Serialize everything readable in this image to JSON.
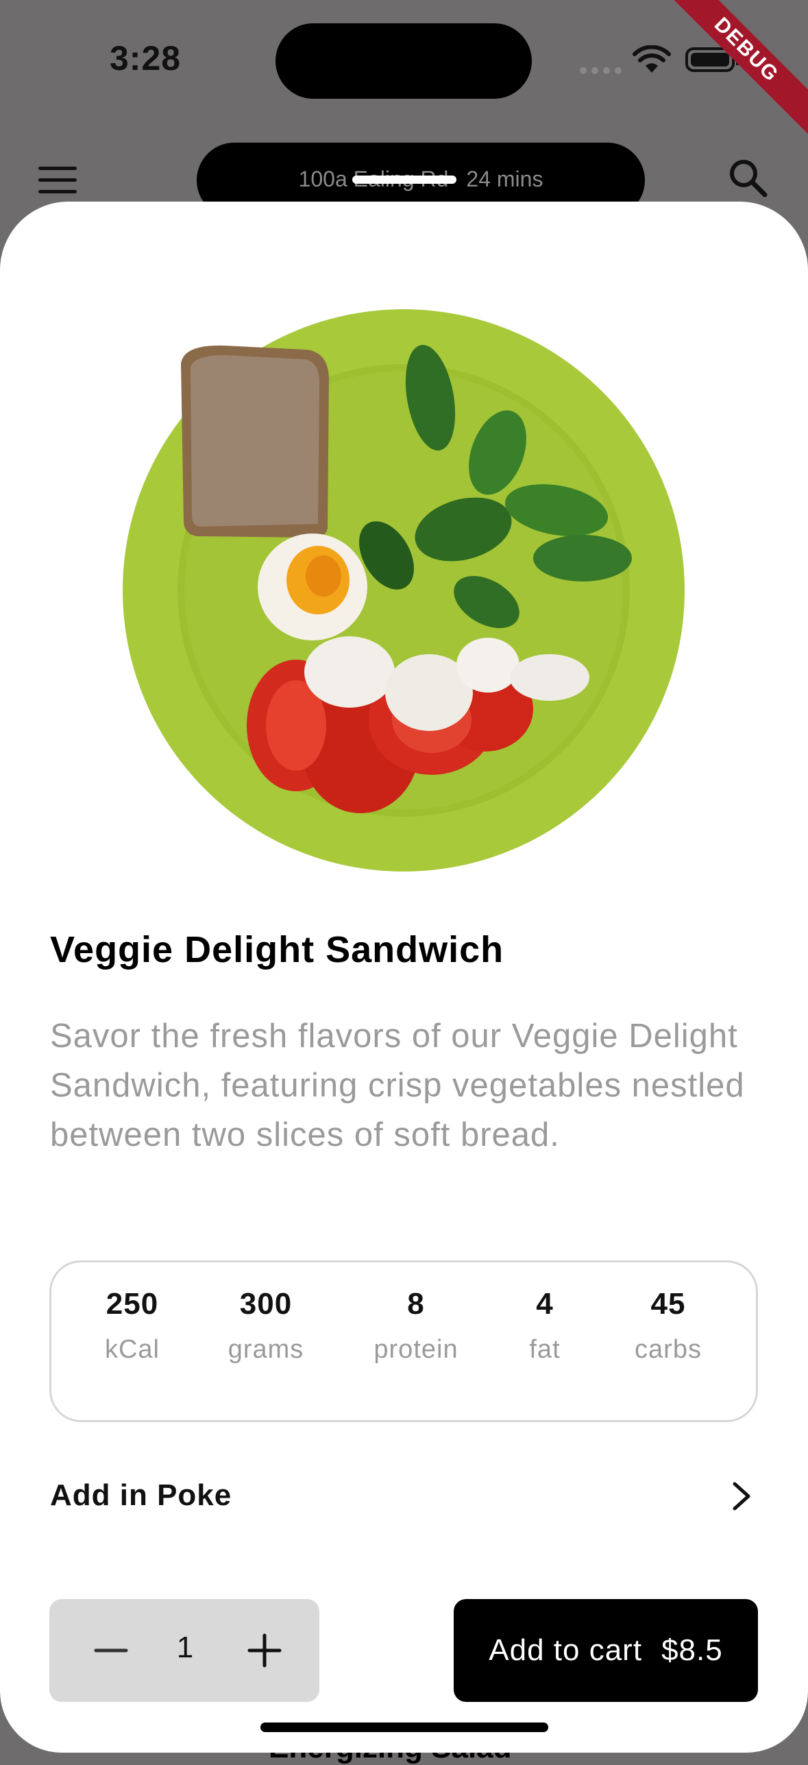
{
  "status_bar": {
    "time": "3:28",
    "debug_banner": "DEBUG"
  },
  "header": {
    "location": "100a Ealing Rd",
    "separator": "•",
    "eta": "24 mins",
    "peek_item": "Energizing Salad"
  },
  "product": {
    "name": "Veggie Delight Sandwich",
    "description": "Savor the fresh flavors of our Veggie Delight Sandwich, featuring crisp vegetables nestled between two slices of soft bread.",
    "nutrition": [
      {
        "value": "250",
        "unit": "kCal"
      },
      {
        "value": "300",
        "unit": "grams"
      },
      {
        "value": "8",
        "unit": "protein"
      },
      {
        "value": "4",
        "unit": "fat"
      },
      {
        "value": "45",
        "unit": "carbs"
      }
    ],
    "add_in_label": "Add in Poke"
  },
  "cart": {
    "quantity": "1",
    "button_label": "Add to cart",
    "price": "$8.5"
  },
  "colors": {
    "accent": "#000000",
    "plate": "#a8c93a",
    "muted_text": "#9a9a9a"
  }
}
